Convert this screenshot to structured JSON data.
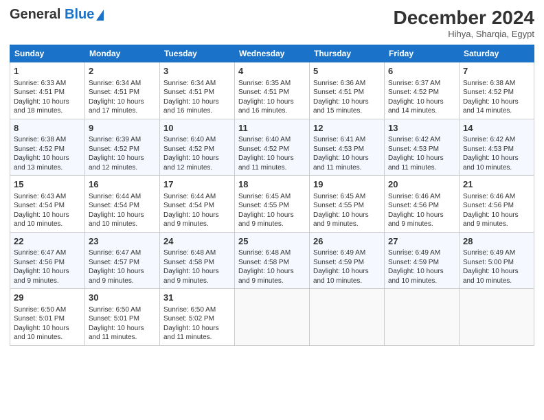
{
  "header": {
    "logo_general": "General",
    "logo_blue": "Blue",
    "month_title": "December 2024",
    "location": "Hihya, Sharqia, Egypt"
  },
  "days_of_week": [
    "Sunday",
    "Monday",
    "Tuesday",
    "Wednesday",
    "Thursday",
    "Friday",
    "Saturday"
  ],
  "weeks": [
    [
      {
        "day": "1",
        "info": "Sunrise: 6:33 AM\nSunset: 4:51 PM\nDaylight: 10 hours\nand 18 minutes."
      },
      {
        "day": "2",
        "info": "Sunrise: 6:34 AM\nSunset: 4:51 PM\nDaylight: 10 hours\nand 17 minutes."
      },
      {
        "day": "3",
        "info": "Sunrise: 6:34 AM\nSunset: 4:51 PM\nDaylight: 10 hours\nand 16 minutes."
      },
      {
        "day": "4",
        "info": "Sunrise: 6:35 AM\nSunset: 4:51 PM\nDaylight: 10 hours\nand 16 minutes."
      },
      {
        "day": "5",
        "info": "Sunrise: 6:36 AM\nSunset: 4:51 PM\nDaylight: 10 hours\nand 15 minutes."
      },
      {
        "day": "6",
        "info": "Sunrise: 6:37 AM\nSunset: 4:52 PM\nDaylight: 10 hours\nand 14 minutes."
      },
      {
        "day": "7",
        "info": "Sunrise: 6:38 AM\nSunset: 4:52 PM\nDaylight: 10 hours\nand 14 minutes."
      }
    ],
    [
      {
        "day": "8",
        "info": "Sunrise: 6:38 AM\nSunset: 4:52 PM\nDaylight: 10 hours\nand 13 minutes."
      },
      {
        "day": "9",
        "info": "Sunrise: 6:39 AM\nSunset: 4:52 PM\nDaylight: 10 hours\nand 12 minutes."
      },
      {
        "day": "10",
        "info": "Sunrise: 6:40 AM\nSunset: 4:52 PM\nDaylight: 10 hours\nand 12 minutes."
      },
      {
        "day": "11",
        "info": "Sunrise: 6:40 AM\nSunset: 4:52 PM\nDaylight: 10 hours\nand 11 minutes."
      },
      {
        "day": "12",
        "info": "Sunrise: 6:41 AM\nSunset: 4:53 PM\nDaylight: 10 hours\nand 11 minutes."
      },
      {
        "day": "13",
        "info": "Sunrise: 6:42 AM\nSunset: 4:53 PM\nDaylight: 10 hours\nand 11 minutes."
      },
      {
        "day": "14",
        "info": "Sunrise: 6:42 AM\nSunset: 4:53 PM\nDaylight: 10 hours\nand 10 minutes."
      }
    ],
    [
      {
        "day": "15",
        "info": "Sunrise: 6:43 AM\nSunset: 4:54 PM\nDaylight: 10 hours\nand 10 minutes."
      },
      {
        "day": "16",
        "info": "Sunrise: 6:44 AM\nSunset: 4:54 PM\nDaylight: 10 hours\nand 10 minutes."
      },
      {
        "day": "17",
        "info": "Sunrise: 6:44 AM\nSunset: 4:54 PM\nDaylight: 10 hours\nand 9 minutes."
      },
      {
        "day": "18",
        "info": "Sunrise: 6:45 AM\nSunset: 4:55 PM\nDaylight: 10 hours\nand 9 minutes."
      },
      {
        "day": "19",
        "info": "Sunrise: 6:45 AM\nSunset: 4:55 PM\nDaylight: 10 hours\nand 9 minutes."
      },
      {
        "day": "20",
        "info": "Sunrise: 6:46 AM\nSunset: 4:56 PM\nDaylight: 10 hours\nand 9 minutes."
      },
      {
        "day": "21",
        "info": "Sunrise: 6:46 AM\nSunset: 4:56 PM\nDaylight: 10 hours\nand 9 minutes."
      }
    ],
    [
      {
        "day": "22",
        "info": "Sunrise: 6:47 AM\nSunset: 4:56 PM\nDaylight: 10 hours\nand 9 minutes."
      },
      {
        "day": "23",
        "info": "Sunrise: 6:47 AM\nSunset: 4:57 PM\nDaylight: 10 hours\nand 9 minutes."
      },
      {
        "day": "24",
        "info": "Sunrise: 6:48 AM\nSunset: 4:58 PM\nDaylight: 10 hours\nand 9 minutes."
      },
      {
        "day": "25",
        "info": "Sunrise: 6:48 AM\nSunset: 4:58 PM\nDaylight: 10 hours\nand 9 minutes."
      },
      {
        "day": "26",
        "info": "Sunrise: 6:49 AM\nSunset: 4:59 PM\nDaylight: 10 hours\nand 10 minutes."
      },
      {
        "day": "27",
        "info": "Sunrise: 6:49 AM\nSunset: 4:59 PM\nDaylight: 10 hours\nand 10 minutes."
      },
      {
        "day": "28",
        "info": "Sunrise: 6:49 AM\nSunset: 5:00 PM\nDaylight: 10 hours\nand 10 minutes."
      }
    ],
    [
      {
        "day": "29",
        "info": "Sunrise: 6:50 AM\nSunset: 5:01 PM\nDaylight: 10 hours\nand 10 minutes."
      },
      {
        "day": "30",
        "info": "Sunrise: 6:50 AM\nSunset: 5:01 PM\nDaylight: 10 hours\nand 11 minutes."
      },
      {
        "day": "31",
        "info": "Sunrise: 6:50 AM\nSunset: 5:02 PM\nDaylight: 10 hours\nand 11 minutes."
      },
      null,
      null,
      null,
      null
    ]
  ]
}
